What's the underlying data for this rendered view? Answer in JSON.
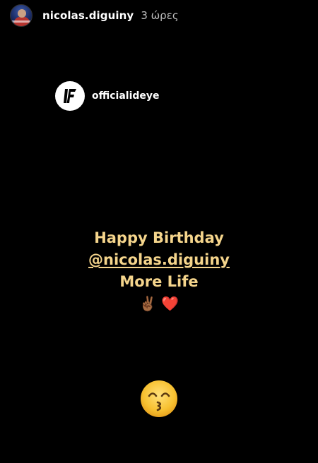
{
  "header": {
    "username": "nicolas.diguiny",
    "time": "3 ώρες"
  },
  "mention_sticker": {
    "username": "officialideye"
  },
  "caption": {
    "line1": "Happy Birthday",
    "mention": "@nicolas.diguiny",
    "line3": "More Life",
    "emojis": "✌🏾 ❤️"
  },
  "sticker": {
    "icon": "kissing-smiling-eyes-emoji"
  },
  "colors": {
    "background": "#000000",
    "caption_text": "#f5d58c",
    "username_text": "#ffffff",
    "time_text": "#bdbdbd",
    "emoji_face": "#f7c131"
  }
}
